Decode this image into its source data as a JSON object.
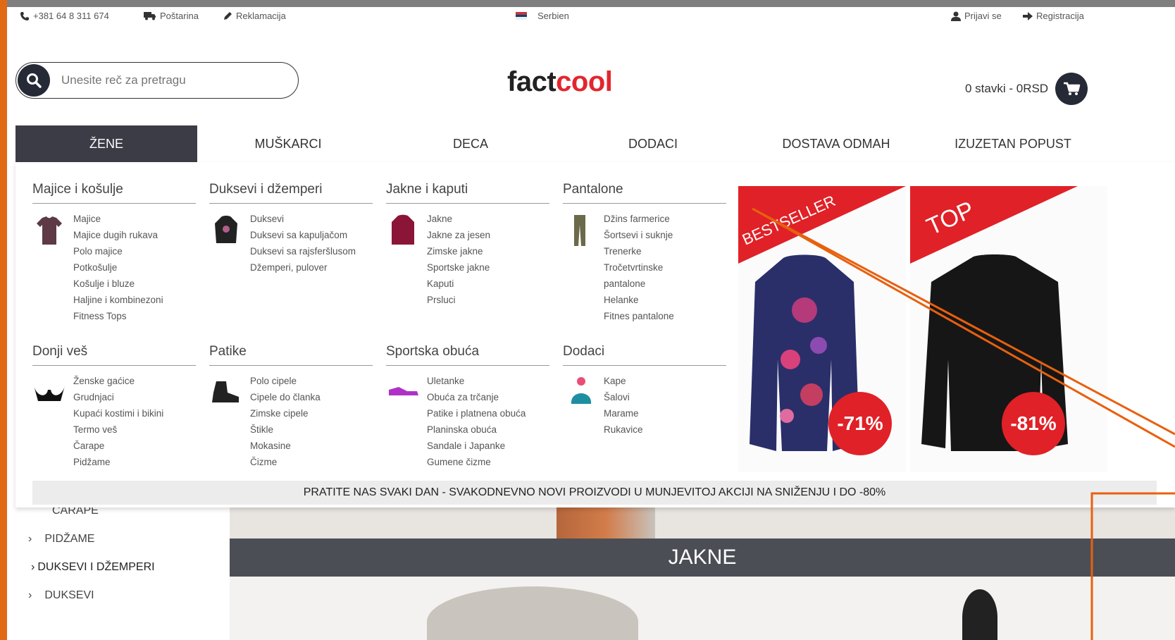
{
  "topbar": {
    "phone": "+381 64 8 311 674",
    "shipping": "Poštarina",
    "complaints": "Reklamacija",
    "country": "Serbien",
    "login": "Prijavi se",
    "register": "Registracija"
  },
  "search": {
    "placeholder": "Unesite reč za pretragu"
  },
  "logo": {
    "part1": "fact",
    "part2": "cool"
  },
  "cart": {
    "summary": "0 stavki - 0RSD"
  },
  "nav": {
    "items": [
      "ŽENE",
      "MUŠKARCI",
      "DECA",
      "DODACI",
      "DOSTAVA ODMAH",
      "IZUZETAN POPUST"
    ]
  },
  "menu": {
    "columns": [
      {
        "title": "Majice i košulje",
        "items": [
          "Majice",
          "Majice dugih rukava",
          "Polo majice",
          "Potkošulje",
          "Košulje i bluze",
          "Haljine i kombinezoni",
          "Fitness Tops"
        ]
      },
      {
        "title": "Duksevi i džemperi",
        "items": [
          "Duksevi",
          "Duksevi sa kapuljačom",
          "Duksevi sa rajsferšlusom",
          "Džemperi, pulover"
        ]
      },
      {
        "title": "Jakne i kaputi",
        "items": [
          "Jakne",
          "Jakne za jesen",
          "Zimske jakne",
          "Sportske jakne",
          "Kaputi",
          "Prsluci"
        ]
      },
      {
        "title": "Pantalone",
        "items": [
          "Džins farmerice",
          "Šortsevi i suknje",
          "Trenerke",
          "Tročetvrtinske pantalone",
          "Helanke",
          "Fitnes pantalone"
        ]
      },
      {
        "title": "Donji veš",
        "items": [
          "Ženske gaćice",
          "Grudnjaci",
          "Kupaći kostimi i bikini",
          "Termo veš",
          "Čarape",
          "Pidžame"
        ]
      },
      {
        "title": "Patike",
        "items": [
          "Polo cipele",
          "Cipele do članka",
          "Zimske cipele",
          "Štikle",
          "Mokasine",
          "Čizme"
        ]
      },
      {
        "title": "Sportska obuća",
        "items": [
          "Uletanke",
          "Obuća za trčanje",
          "Patike i platnena obuća",
          "Planinska obuća",
          "Sandale i Japanke",
          "Gumene čizme"
        ]
      },
      {
        "title": "Dodaci",
        "items": [
          "Kape",
          "Šalovi",
          "Marame",
          "Rukavice"
        ]
      }
    ],
    "promo": "PRATITE NAS SVAKI DAN - SVAKODNEVNO NOVI PROIZVODI U MUNJEVITOJ AKCIJI NA SNIŽENJU I DO -80%"
  },
  "products": [
    {
      "badge": "BESTSELLER",
      "discount": "-71%"
    },
    {
      "badge": "TOP",
      "discount": "-81%"
    }
  ],
  "sidebar": {
    "items": [
      "ČARAPE",
      "PIDŽAME",
      "DUKSEVI I DŽEMPERI",
      "DUKSEVI"
    ]
  },
  "banner": {
    "label": "JAKNE"
  },
  "colors": {
    "accent": "#e3262d",
    "dark": "#262a36",
    "annotation": "#e8600e"
  }
}
